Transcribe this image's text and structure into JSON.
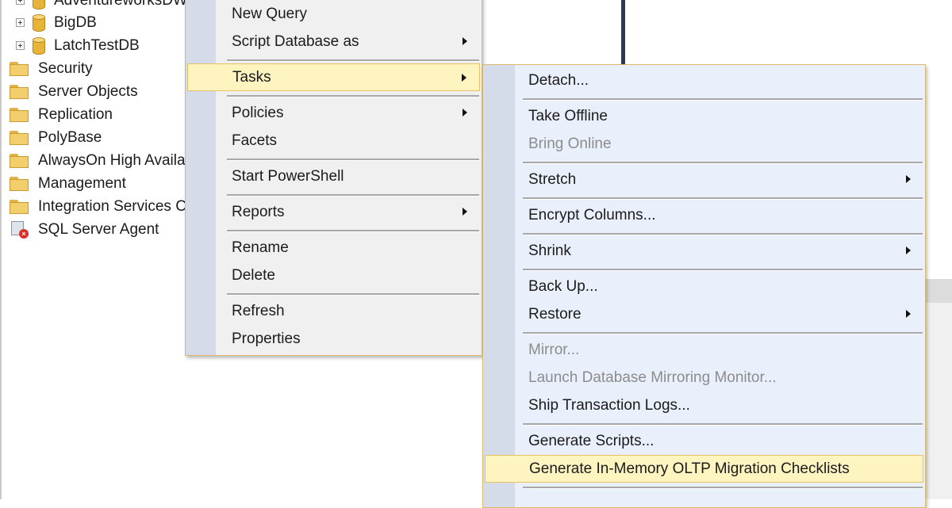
{
  "tree": {
    "databases": [
      "AdventureworksDW",
      "BigDB",
      "LatchTestDB"
    ],
    "folders": [
      "Security",
      "Server Objects",
      "Replication",
      "PolyBase",
      "AlwaysOn High Availa",
      "Management",
      "Integration Services Ca"
    ],
    "agent": "SQL Server Agent"
  },
  "context_menu": {
    "new_query": "New Query",
    "script_database_as": "Script Database as",
    "tasks": "Tasks",
    "policies": "Policies",
    "facets": "Facets",
    "start_powershell": "Start PowerShell",
    "reports": "Reports",
    "rename": "Rename",
    "delete": "Delete",
    "refresh": "Refresh",
    "properties": "Properties"
  },
  "tasks_menu": {
    "detach": "Detach...",
    "take_offline": "Take Offline",
    "bring_online": "Bring Online",
    "stretch": "Stretch",
    "encrypt_columns": "Encrypt Columns...",
    "shrink": "Shrink",
    "back_up": "Back Up...",
    "restore": "Restore",
    "mirror": "Mirror...",
    "launch_mirroring_monitor": "Launch Database Mirroring Monitor...",
    "ship_transaction_logs": "Ship Transaction Logs...",
    "generate_scripts": "Generate Scripts...",
    "generate_inmemory_checklists": "Generate In-Memory OLTP Migration Checklists"
  },
  "colors": {
    "highlight": "#fdf4bf",
    "highlight_border": "#e5c365",
    "gutter": "#d6dbe9",
    "disabled_text": "#8c8c8c"
  }
}
